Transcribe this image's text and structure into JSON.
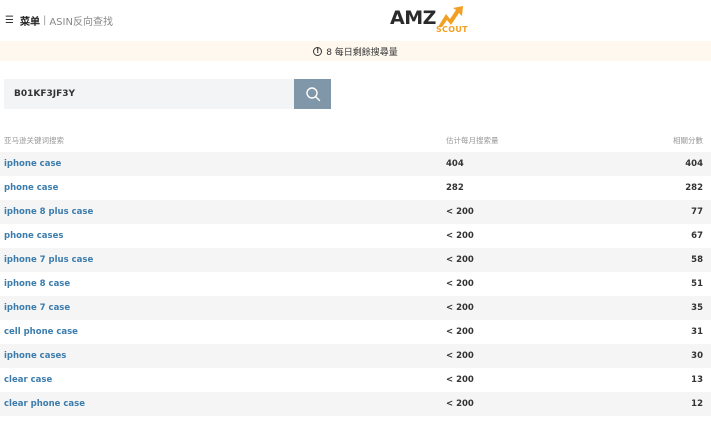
{
  "header": {
    "menu_icon": "hamburger-icon",
    "menu_label": "菜单",
    "separator": "|",
    "page_name": "ASIN反向查找",
    "logo_text": "AMZ",
    "logo_sub": "SCOUT",
    "brand_color": "#f2a024"
  },
  "notice": {
    "icon": "info-icon",
    "text": "8 每日剩餘搜尋量"
  },
  "search": {
    "value": "B01KF3JF3Y",
    "button_icon": "search-icon",
    "button_color": "#7f97a8"
  },
  "table": {
    "headers": [
      "亚马逊关键词搜索",
      "估计每月搜索量",
      "相關分數"
    ],
    "rows": [
      {
        "keyword": "iphone case",
        "volume": "404",
        "score": "404"
      },
      {
        "keyword": "phone case",
        "volume": "282",
        "score": "282"
      },
      {
        "keyword": "iphone 8 plus case",
        "volume": "< 200",
        "score": "77"
      },
      {
        "keyword": "phone cases",
        "volume": "< 200",
        "score": "67"
      },
      {
        "keyword": "iphone 7 plus case",
        "volume": "< 200",
        "score": "58"
      },
      {
        "keyword": "iphone 8 case",
        "volume": "< 200",
        "score": "51"
      },
      {
        "keyword": "iphone 7 case",
        "volume": "< 200",
        "score": "35"
      },
      {
        "keyword": "cell phone case",
        "volume": "< 200",
        "score": "31"
      },
      {
        "keyword": "iphone cases",
        "volume": "< 200",
        "score": "30"
      },
      {
        "keyword": "clear case",
        "volume": "< 200",
        "score": "13"
      },
      {
        "keyword": "clear phone case",
        "volume": "< 200",
        "score": "12"
      }
    ],
    "link_color": "#3d7dad"
  }
}
